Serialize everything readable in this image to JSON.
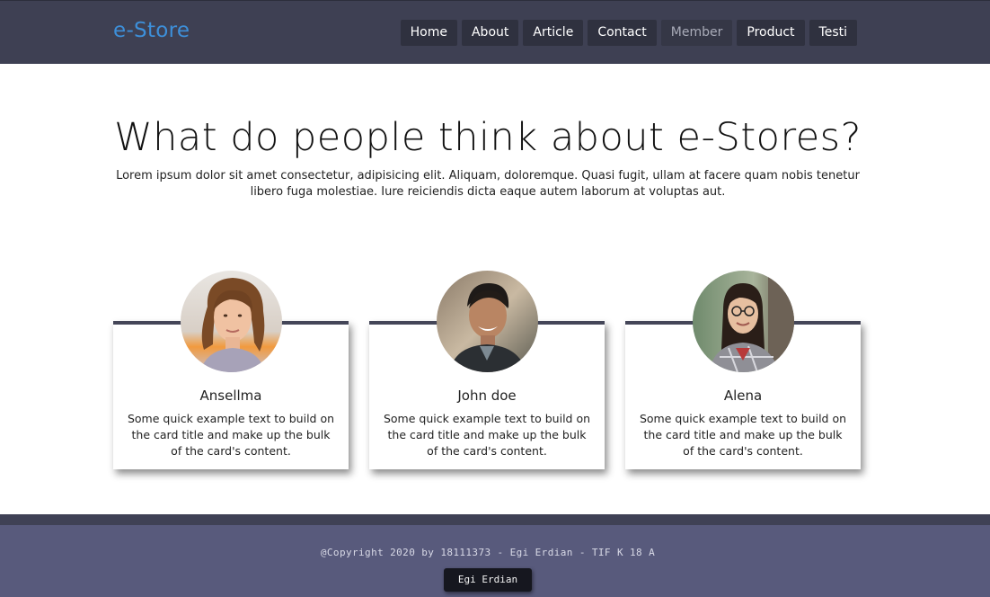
{
  "navbar": {
    "brand": "e-Store",
    "items": [
      {
        "label": "Home"
      },
      {
        "label": "About"
      },
      {
        "label": "Article"
      },
      {
        "label": "Contact"
      },
      {
        "label": "Member",
        "active": true
      },
      {
        "label": "Product"
      },
      {
        "label": "Testi"
      }
    ]
  },
  "hero": {
    "title": "What do people think about e-Stores?",
    "text": "Lorem ipsum dolor sit amet consectetur, adipisicing elit. Aliquam, doloremque. Quasi fugit, ullam at facere quam nobis tenetur libero fuga molestiae. Iure reiciendis dicta eaque autem laborum at voluptas aut."
  },
  "testimonials": [
    {
      "name": "Ansellma",
      "text": "Some quick example text to build on the card title and make up the bulk of the card's content."
    },
    {
      "name": "John doe",
      "text": "Some quick example text to build on the card title and make up the bulk of the card's content."
    },
    {
      "name": "Alena",
      "text": "Some quick example text to build on the card title and make up the bulk of the card's content."
    }
  ],
  "footer": {
    "copyright": "@Copyright 2020 by 18111373 - Egi Erdian - TIF K 18 A",
    "author": "Egi Erdian"
  },
  "colors": {
    "navbar": "#3e4053",
    "brand": "#3d8fd9",
    "footer": "#585a7c",
    "card_border": "#444658"
  }
}
